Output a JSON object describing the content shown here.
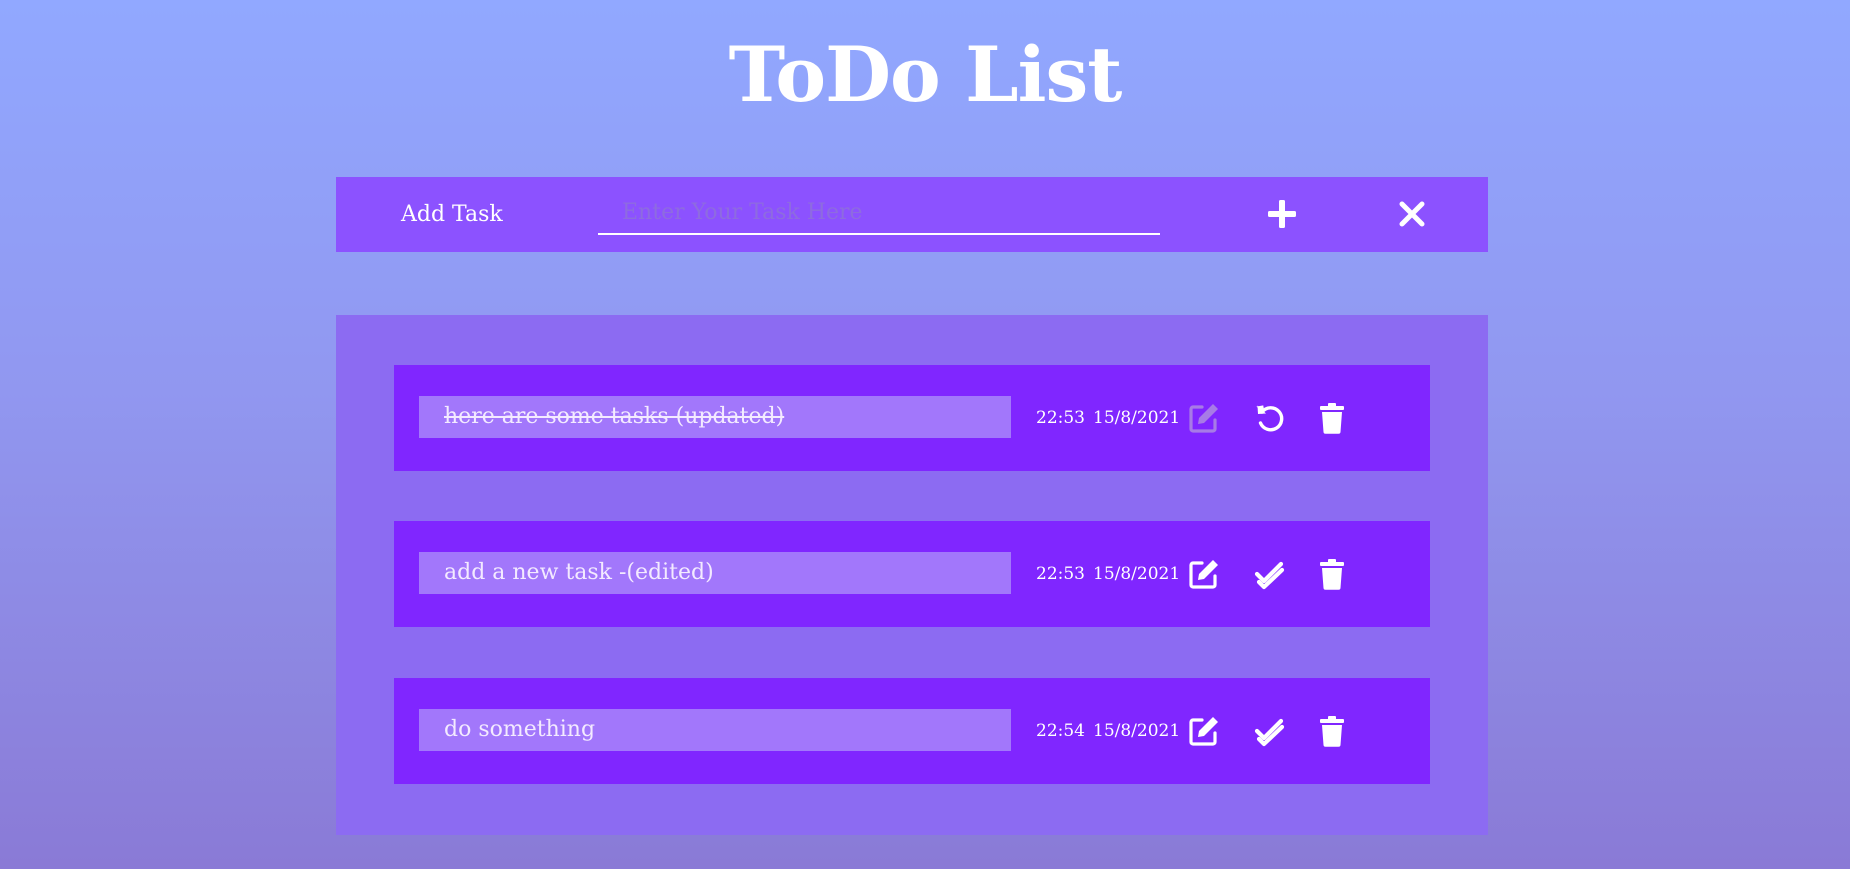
{
  "app": {
    "title": "ToDo List"
  },
  "add_bar": {
    "label": "Add Task",
    "input_value": "",
    "input_placeholder": "Enter Your Task Here",
    "add_icon": "plus-icon",
    "clear_icon": "close-icon"
  },
  "tasks": [
    {
      "text": "here are some tasks (updated)",
      "time": "22:53",
      "date": "15/8/2021",
      "completed": true,
      "edit_icon": "edit-icon",
      "toggle_icon": "undo-icon",
      "delete_icon": "trash-icon"
    },
    {
      "text": "add a new task -(edited)",
      "time": "22:53",
      "date": "15/8/2021",
      "completed": false,
      "edit_icon": "edit-icon",
      "toggle_icon": "double-check-icon",
      "delete_icon": "trash-icon"
    },
    {
      "text": "do something",
      "time": "22:54",
      "date": "15/8/2021",
      "completed": false,
      "edit_icon": "edit-icon",
      "toggle_icon": "double-check-icon",
      "delete_icon": "trash-icon"
    }
  ],
  "colors": {
    "bar": "#8c52ff",
    "panel": "#8c6bf2",
    "card": "#8026ff",
    "task_field": "#a277fb"
  }
}
